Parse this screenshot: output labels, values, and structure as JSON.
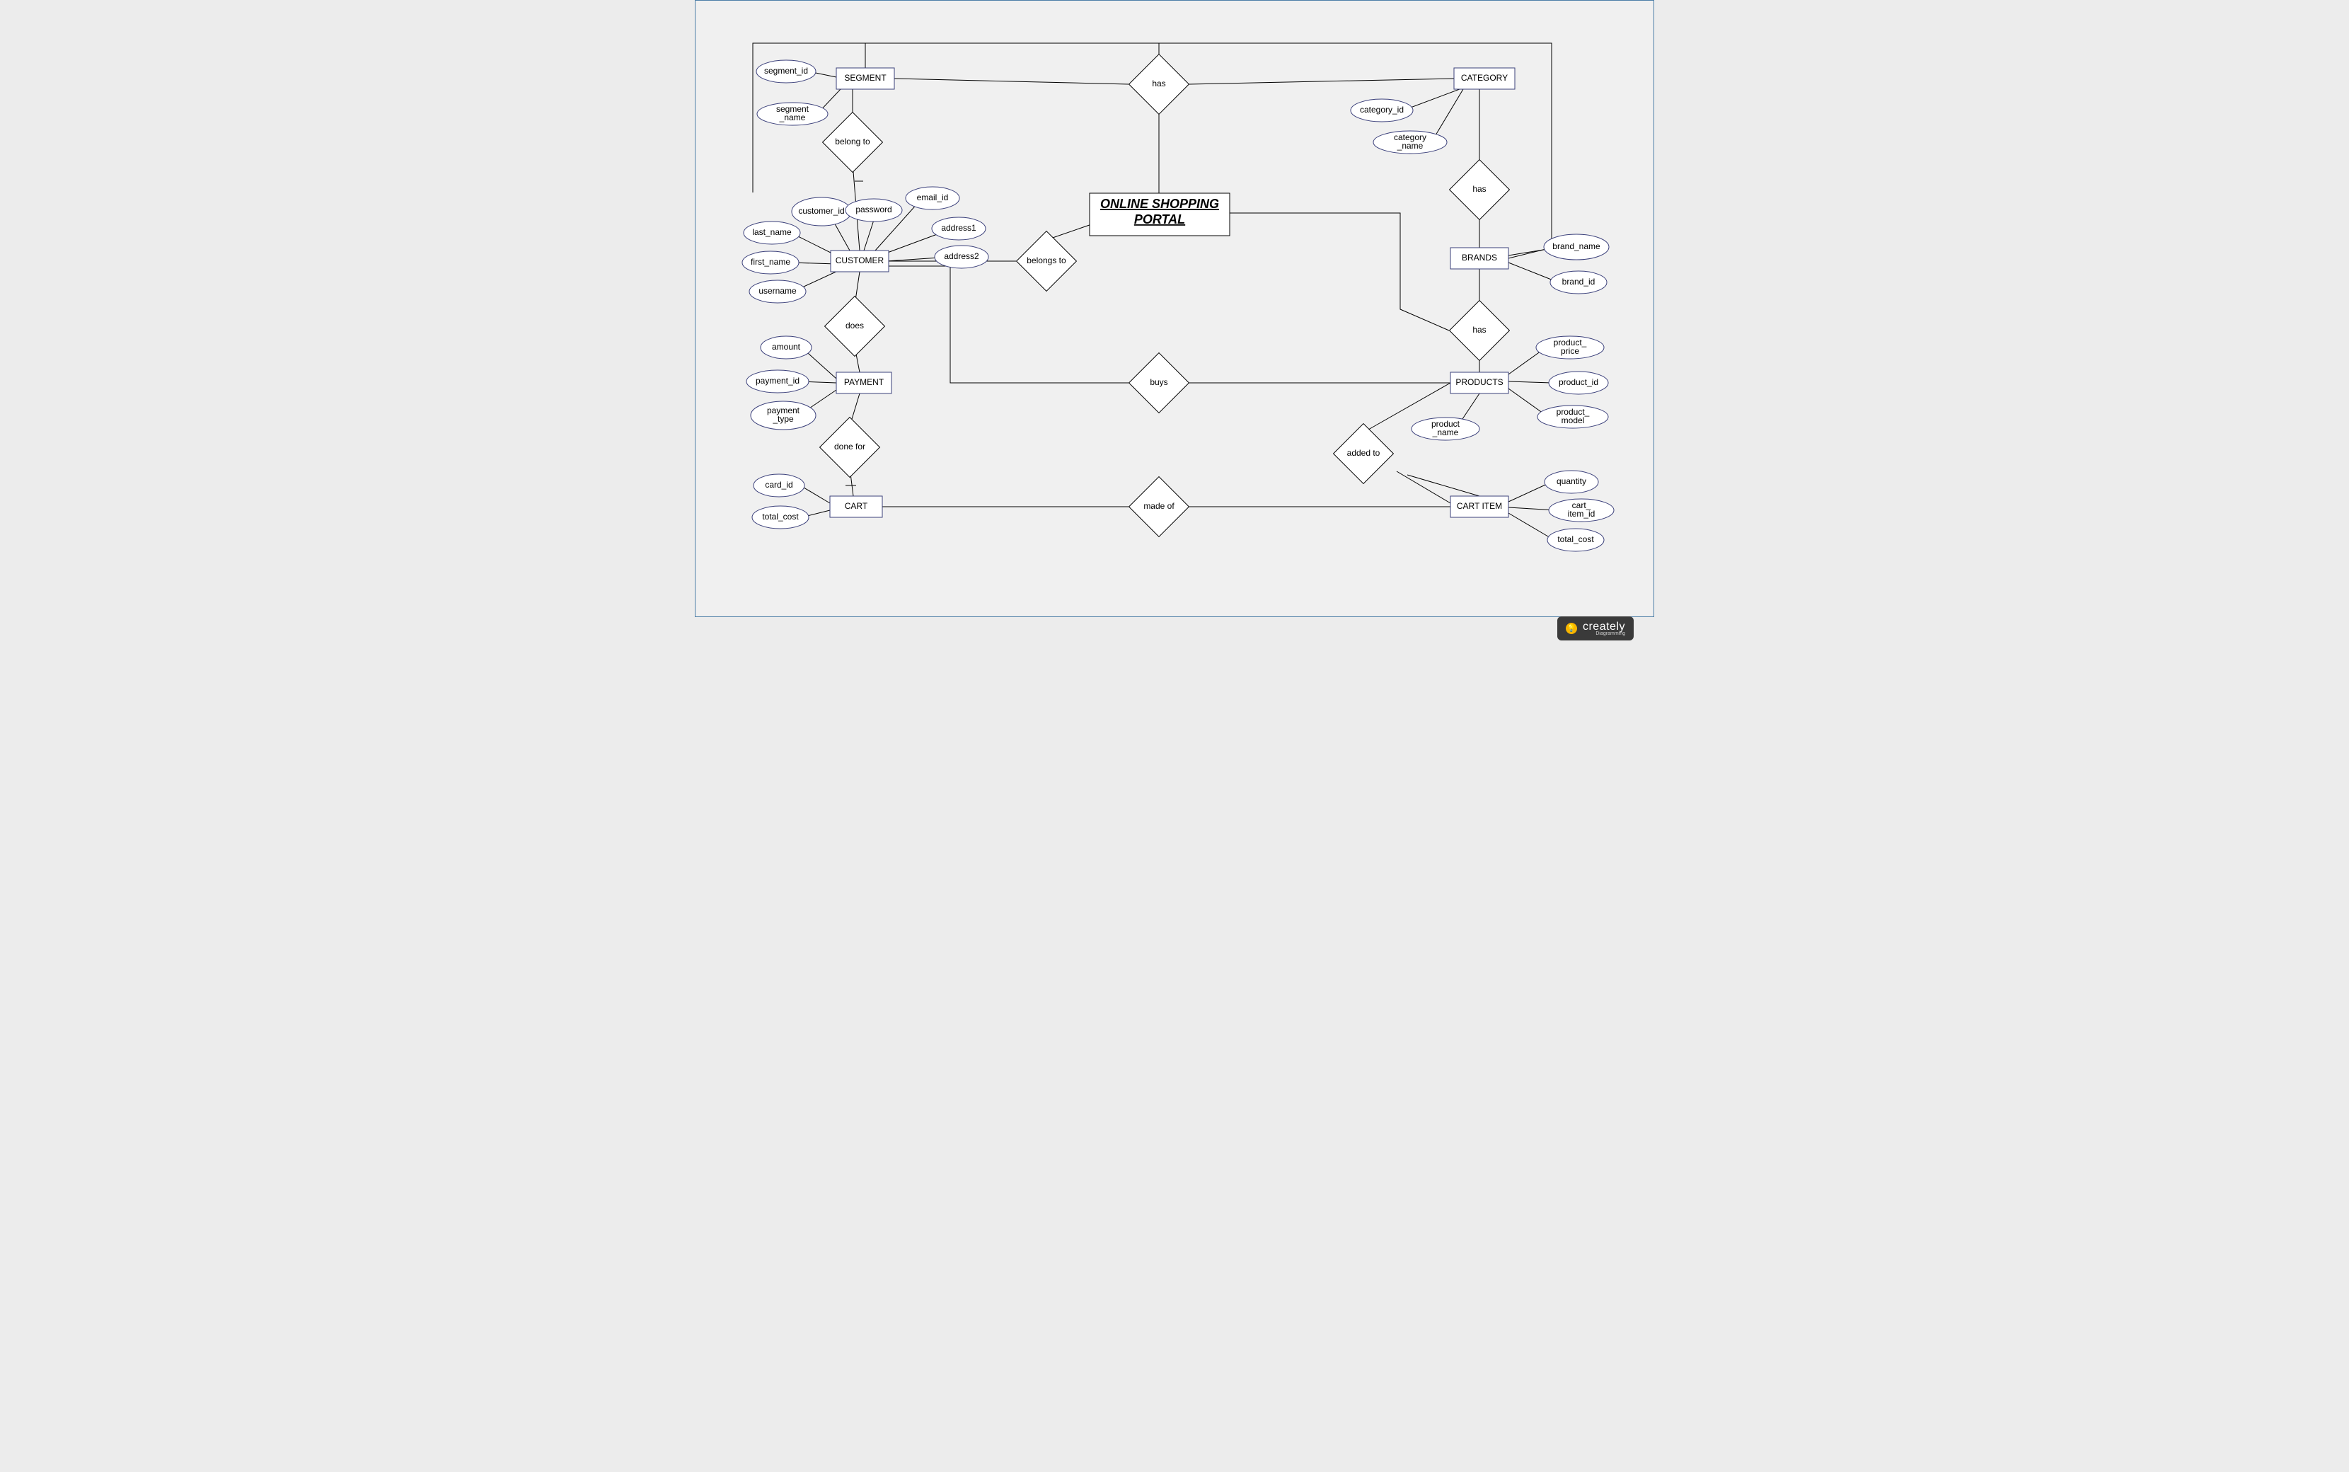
{
  "title": "ONLINE SHOPPING PORTAL",
  "entities": {
    "segment": "SEGMENT",
    "category": "CATEGORY",
    "brands": "BRANDS",
    "customer": "CUSTOMER",
    "payment": "PAYMENT",
    "cart": "CART",
    "products": "PRODUCTS",
    "cart_item": "CART ITEM"
  },
  "relationships": {
    "has1": "has",
    "has2": "has",
    "has3": "has",
    "belong_to": "belong to",
    "belongs_to": "belongs to",
    "does": "does",
    "done_for": "done for",
    "buys": "buys",
    "added_to": "added to",
    "made_of": "made of"
  },
  "attributes": {
    "segment_id": "segment_id",
    "segment_name": "segment_name",
    "category_id": "category_id",
    "category_name": "category_name",
    "brand_name": "brand_name",
    "brand_id": "brand_id",
    "customer_id": "customer_id",
    "password": "password",
    "email_id": "email_id",
    "last_name": "last_name",
    "first_name": "first_name",
    "username": "username",
    "address1": "address1",
    "address2": "address2",
    "amount": "amount",
    "payment_id": "payment_id",
    "payment_type": "payment_type",
    "card_id": "card_id",
    "total_cost_cart": "total_cost",
    "product_price": "product_price",
    "product_id": "product_id",
    "product_model": "product_model",
    "product_name": "product_name",
    "quantity": "quantity",
    "cart_item_id": "cart_item_id",
    "total_cost_ci": "total_cost"
  },
  "logo": {
    "brand": "creately",
    "sub": "Diagramming"
  }
}
